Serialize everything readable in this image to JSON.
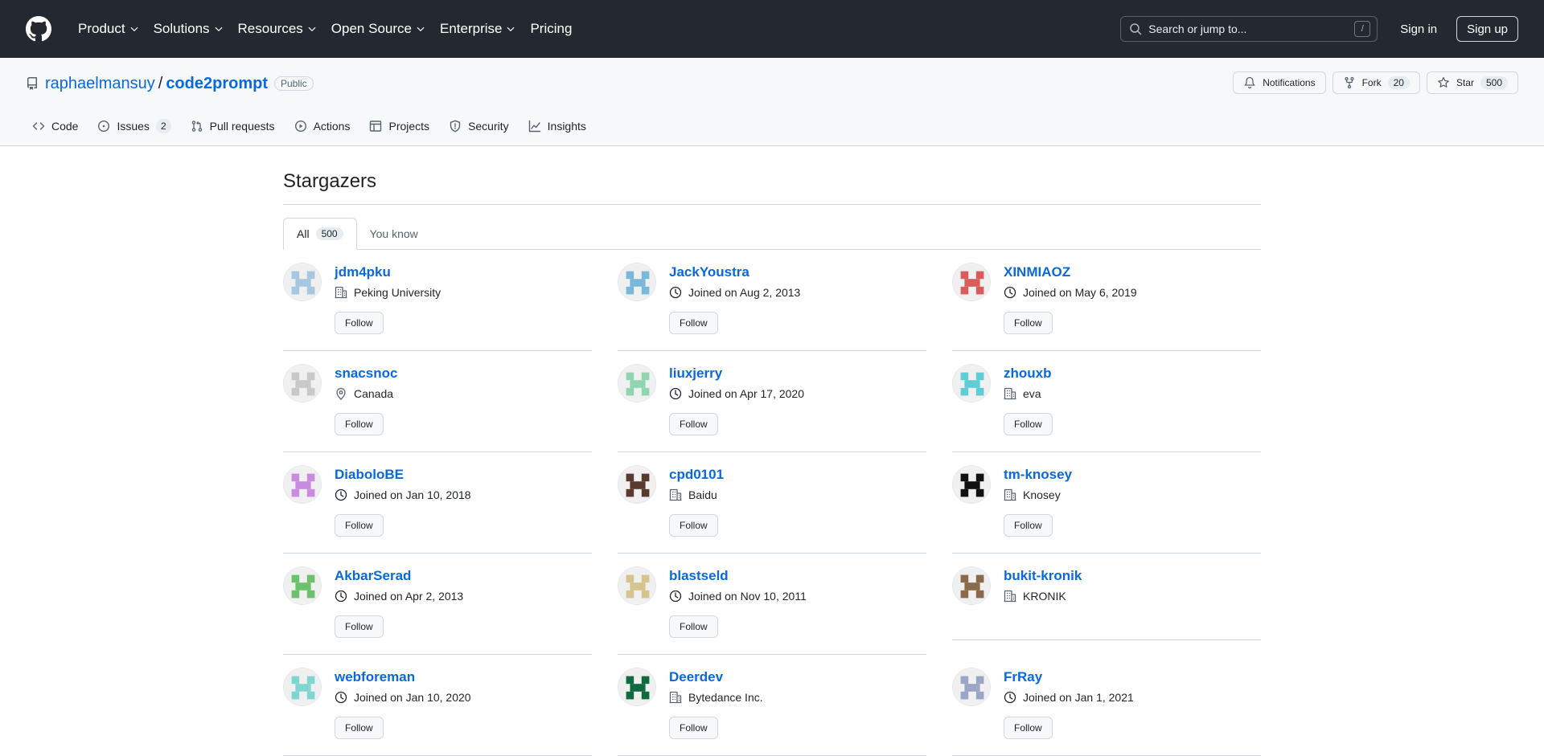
{
  "header": {
    "nav": [
      "Product",
      "Solutions",
      "Resources",
      "Open Source",
      "Enterprise",
      "Pricing"
    ],
    "search_placeholder": "Search or jump to...",
    "search_shortcut": "/",
    "sign_in": "Sign in",
    "sign_up": "Sign up"
  },
  "repo": {
    "owner": "raphaelmansuy",
    "separator": "/",
    "name": "code2prompt",
    "visibility": "Public",
    "notifications_label": "Notifications",
    "fork_label": "Fork",
    "fork_count": "20",
    "star_label": "Star",
    "star_count": "500"
  },
  "tabs": [
    {
      "label": "Code",
      "icon": "code-icon"
    },
    {
      "label": "Issues",
      "icon": "issue-icon",
      "count": "2"
    },
    {
      "label": "Pull requests",
      "icon": "pull-request-icon"
    },
    {
      "label": "Actions",
      "icon": "play-icon"
    },
    {
      "label": "Projects",
      "icon": "table-icon"
    },
    {
      "label": "Security",
      "icon": "shield-icon"
    },
    {
      "label": "Insights",
      "icon": "graph-icon"
    }
  ],
  "page": {
    "title": "Stargazers",
    "subtabs": [
      {
        "label": "All",
        "count": "500"
      },
      {
        "label": "You know"
      }
    ],
    "follow_label": "Follow"
  },
  "users": [
    {
      "name": "jdm4pku",
      "meta_icon": "organization-icon",
      "meta": "Peking University",
      "avatar_color": "#a7c6e0",
      "follow": true
    },
    {
      "name": "JackYoustra",
      "meta_icon": "clock-icon",
      "meta": "Joined on Aug 2, 2013",
      "avatar_color": "#7ab8d9",
      "follow": true
    },
    {
      "name": "XINMIAOZ",
      "meta_icon": "clock-icon",
      "meta": "Joined on May 6, 2019",
      "avatar_color": "#d95c5c",
      "follow": true
    },
    {
      "name": "snacsnoc",
      "meta_icon": "location-icon",
      "meta": "Canada",
      "avatar_color": "#c8c8c8",
      "follow": true
    },
    {
      "name": "liuxjerry",
      "meta_icon": "clock-icon",
      "meta": "Joined on Apr 17, 2020",
      "avatar_color": "#8fd6b0",
      "follow": true
    },
    {
      "name": "zhouxb",
      "meta_icon": "organization-icon",
      "meta": "eva",
      "avatar_color": "#5fcdd6",
      "follow": true
    },
    {
      "name": "DiaboloBE",
      "meta_icon": "clock-icon",
      "meta": "Joined on Jan 10, 2018",
      "avatar_color": "#c98be0",
      "follow": true
    },
    {
      "name": "cpd0101",
      "meta_icon": "organization-icon",
      "meta": "Baidu",
      "avatar_color": "#5a3a2e",
      "follow": true
    },
    {
      "name": "tm-knosey",
      "meta_icon": "organization-icon",
      "meta": "Knosey",
      "avatar_color": "#111111",
      "follow": true
    },
    {
      "name": "AkbarSerad",
      "meta_icon": "clock-icon",
      "meta": "Joined on Apr 2, 2013",
      "avatar_color": "#6cc26c",
      "follow": true
    },
    {
      "name": "blastseld",
      "meta_icon": "clock-icon",
      "meta": "Joined on Nov 10, 2011",
      "avatar_color": "#d6c48f",
      "follow": true
    },
    {
      "name": "bukit-kronik",
      "meta_icon": "organization-icon",
      "meta": "KRONIK",
      "avatar_color": "#8a6a4a",
      "follow": false
    },
    {
      "name": "webforeman",
      "meta_icon": "clock-icon",
      "meta": "Joined on Jan 10, 2020",
      "avatar_color": "#7fd6d0",
      "follow": true
    },
    {
      "name": "Deerdev",
      "meta_icon": "organization-icon",
      "meta": "Bytedance Inc.",
      "avatar_color": "#0f6b3f",
      "follow": true
    },
    {
      "name": "FrRay",
      "meta_icon": "clock-icon",
      "meta": "Joined on Jan 1, 2021",
      "avatar_color": "#9aa6c4",
      "follow": true
    }
  ],
  "colors": {
    "header_bg": "#24292f",
    "link": "#0969da",
    "border": "#d0d7de"
  }
}
